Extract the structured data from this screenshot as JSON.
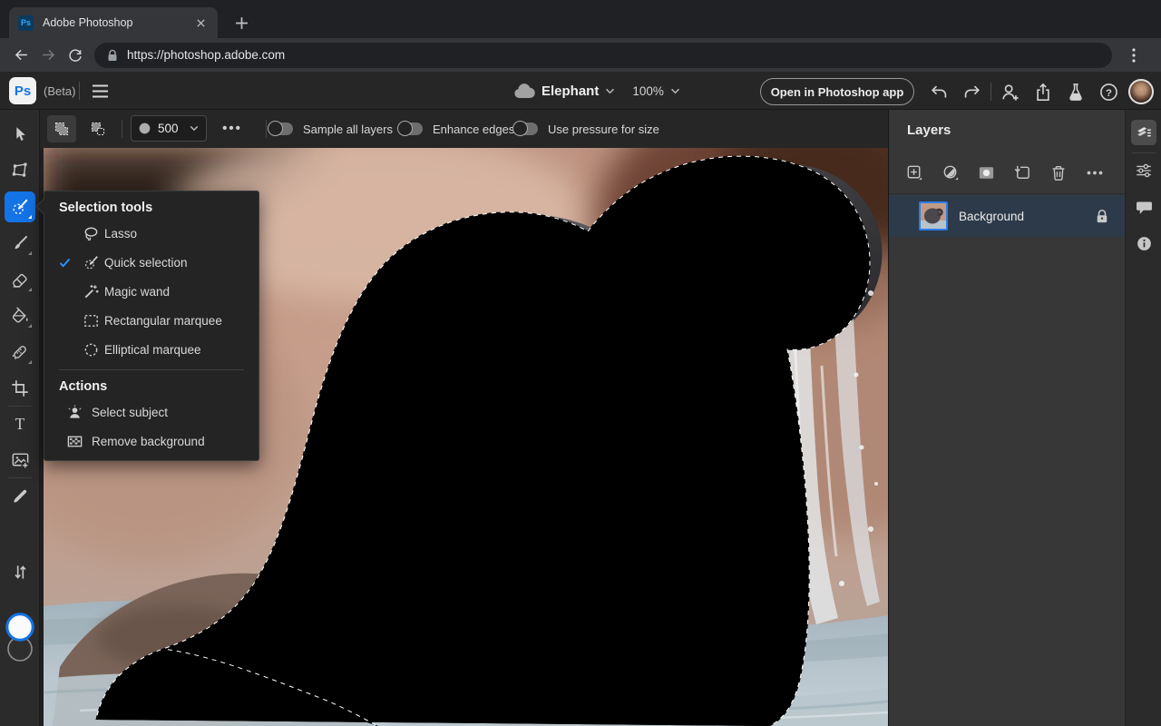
{
  "browser": {
    "tab_title": "Adobe Photoshop",
    "favicon_text": "Ps",
    "url": "https://photoshop.adobe.com"
  },
  "header": {
    "logo_text": "Ps",
    "beta_label": "(Beta)",
    "document_name": "Elephant",
    "zoom_value": "100%",
    "open_app_button": "Open in Photoshop app"
  },
  "options_bar": {
    "brush_size": "500",
    "more_label": "•••",
    "toggles": [
      {
        "label": "Sample all layers",
        "on": false
      },
      {
        "label": "Enhance edges",
        "on": false
      },
      {
        "label": "Use pressure for size",
        "on": false
      }
    ]
  },
  "toolbar_icons": [
    "move-icon",
    "transform-icon",
    "quick-selection-icon",
    "brush-icon",
    "eraser-icon",
    "fill-icon",
    "heal-icon",
    "crop-icon",
    "type-icon",
    "place-image-icon",
    "eyedropper-icon",
    "color-swatches",
    "swap-colors-icon"
  ],
  "selection_menu": {
    "title": "Selection tools",
    "tools": [
      {
        "label": "Lasso",
        "icon": "lasso-icon",
        "checked": false
      },
      {
        "label": "Quick selection",
        "icon": "quick-selection-icon",
        "checked": true
      },
      {
        "label": "Magic wand",
        "icon": "magic-wand-icon",
        "checked": false
      },
      {
        "label": "Rectangular marquee",
        "icon": "rectangular-marquee-icon",
        "checked": false
      },
      {
        "label": "Elliptical marquee",
        "icon": "elliptical-marquee-icon",
        "checked": false
      }
    ],
    "actions_title": "Actions",
    "actions": [
      {
        "label": "Select subject",
        "icon": "select-subject-icon"
      },
      {
        "label": "Remove background",
        "icon": "remove-background-icon"
      }
    ]
  },
  "layers_panel": {
    "title": "Layers",
    "layers": [
      {
        "name": "Background",
        "locked": true,
        "selected": true
      }
    ]
  },
  "colors": {
    "tool_accent_blue": "#1473e6",
    "check_blue": "#2e90fa",
    "selected_layer_bg": "#2d3a49"
  }
}
